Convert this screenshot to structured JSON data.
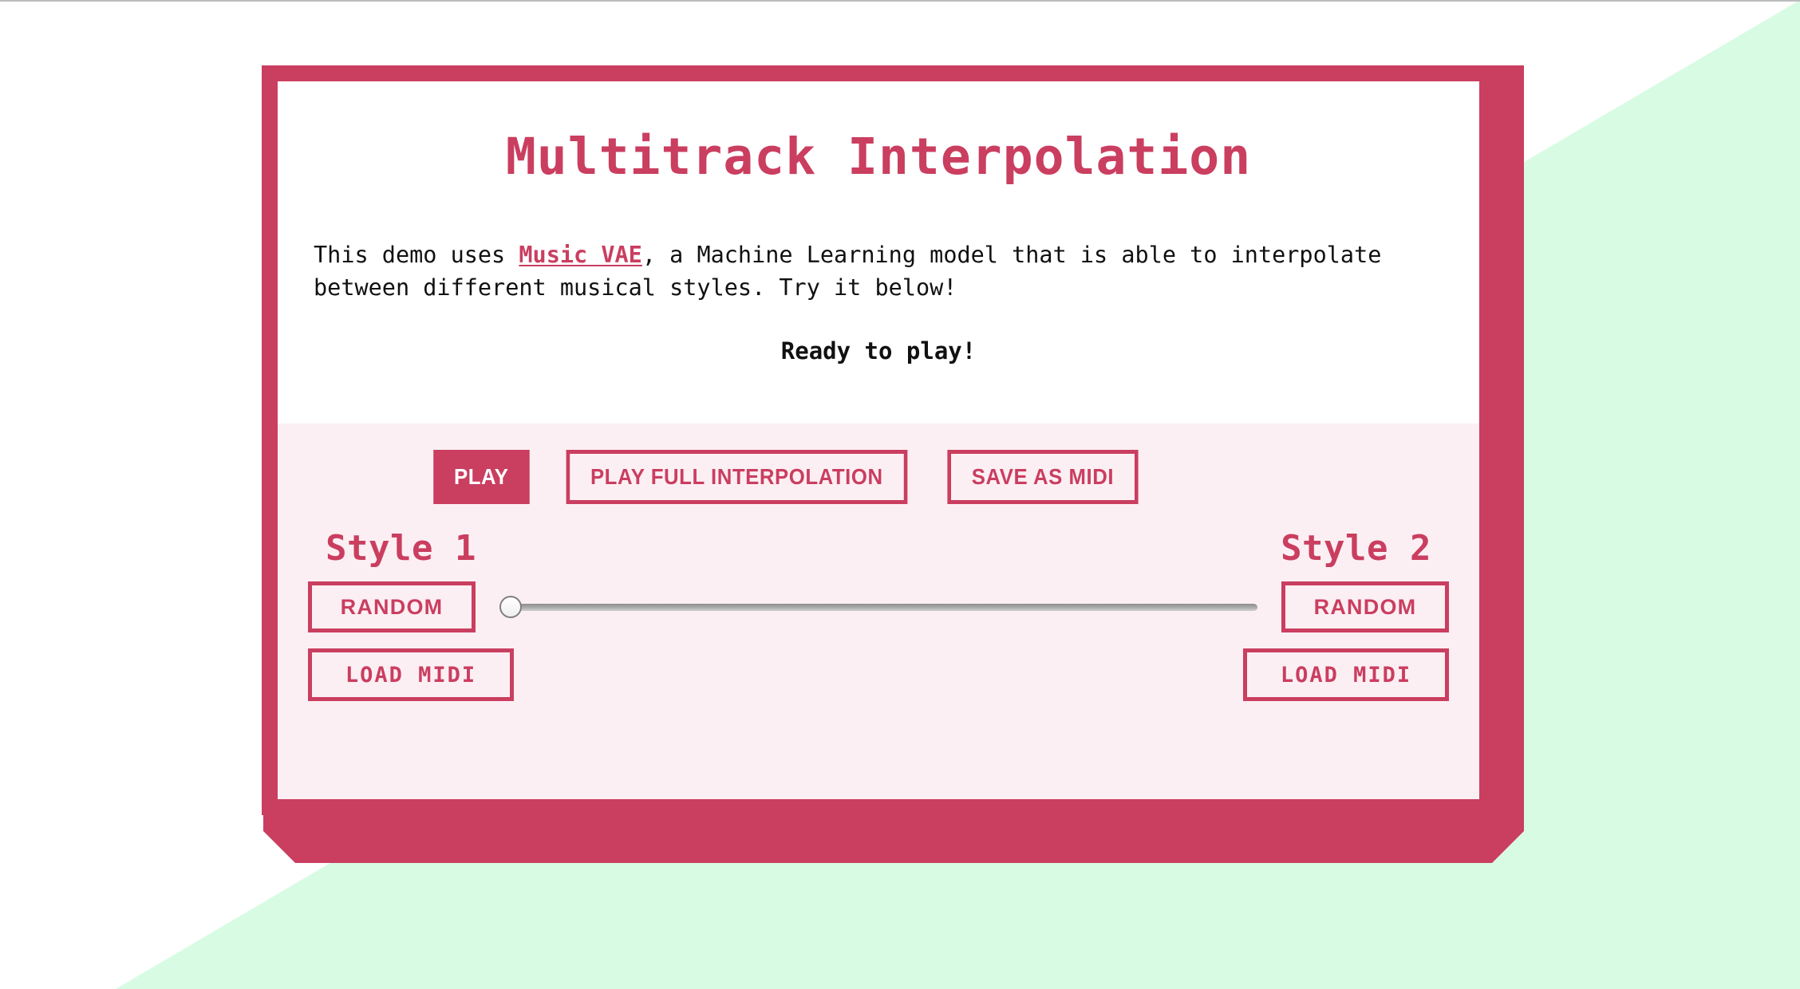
{
  "background": {
    "base_color": "#ffffff",
    "accent_wedge_color": "#d8fbe3",
    "hairline_color": "#bcbcbc"
  },
  "theme": {
    "primary": "#ca3e60",
    "panel": "#fceff3",
    "card_bg": "#ffffff",
    "text": "#111111"
  },
  "card": {
    "title": "Multitrack Interpolation",
    "intro": {
      "before_link": "This demo uses ",
      "link_text": "Music VAE",
      "after_link": ", a Machine Learning model that is able to interpolate between different musical styles. Try it below!"
    },
    "status": "Ready to play!"
  },
  "transport": {
    "play_label": "PLAY",
    "play_full_label": "PLAY FULL INTERPOLATION",
    "save_midi_label": "SAVE AS MIDI"
  },
  "styles": {
    "left": {
      "heading": "Style 1",
      "random_label": "RANDOM",
      "load_midi_label": "LOAD MIDI"
    },
    "right": {
      "heading": "Style 2",
      "random_label": "RANDOM",
      "load_midi_label": "LOAD MIDI"
    }
  },
  "slider": {
    "value": "0",
    "min": "0",
    "max": "100"
  }
}
